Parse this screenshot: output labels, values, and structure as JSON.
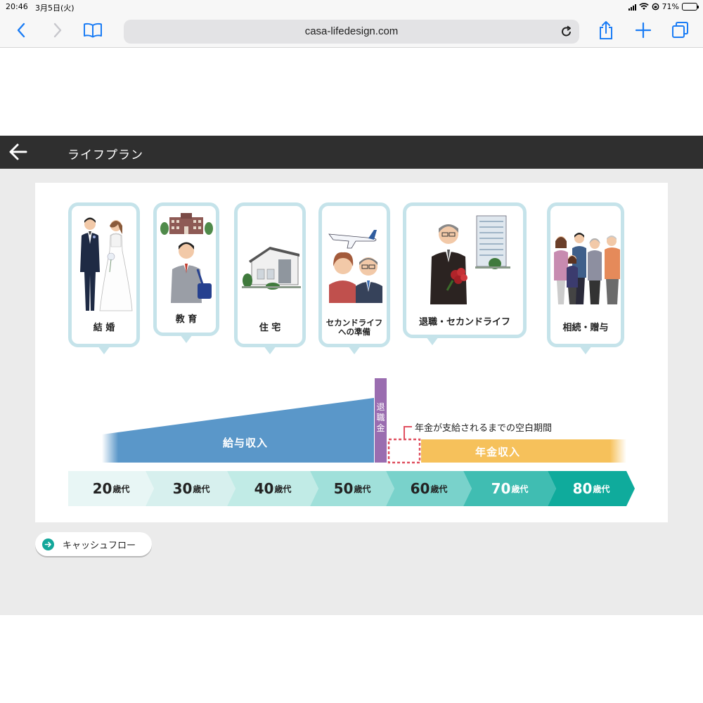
{
  "status": {
    "time": "20:46",
    "date": "3月5日(火)",
    "battery": "71%",
    "battery_level": 0.71
  },
  "browser": {
    "url": "casa-lifedesign.com"
  },
  "header": {
    "title": "ライフプラン"
  },
  "events": [
    {
      "label": "結 婚",
      "icon": "wedding-couple"
    },
    {
      "label": "教 育",
      "icon": "student-school"
    },
    {
      "label": "住 宅",
      "icon": "house"
    },
    {
      "label": "セカンドライフへの準備",
      "label_lines": [
        "セカンドライフ",
        "への準備"
      ],
      "icon": "senior-couple-airplane"
    },
    {
      "label": "退職・セカンドライフ",
      "icon": "retiree-bouquet-building"
    },
    {
      "label": "相続・贈与",
      "icon": "family-generations"
    }
  ],
  "income": {
    "salary_label": "給与収入",
    "retirement_label": "退職金",
    "retirement_chars": [
      "退",
      "職",
      "金"
    ],
    "gap_label": "年金が支給されるまでの空白期間",
    "pension_label": "年金収入"
  },
  "ages": [
    {
      "num": "20",
      "unit": "歳代"
    },
    {
      "num": "30",
      "unit": "歳代"
    },
    {
      "num": "40",
      "unit": "歳代"
    },
    {
      "num": "50",
      "unit": "歳代"
    },
    {
      "num": "60",
      "unit": "歳代"
    },
    {
      "num": "70",
      "unit": "歳代"
    },
    {
      "num": "80",
      "unit": "歳代"
    }
  ],
  "colors": {
    "accent": "#1a7cf5",
    "bubble_border": "#c5e3ea",
    "salary": "#5a97c9",
    "retirement": "#9a6db0",
    "gap": "#e05060",
    "pension": "#f6c15b",
    "age_shades": [
      "#e8f6f5",
      "#d7f0ee",
      "#c1ebe6",
      "#a0e0da",
      "#79d2cb",
      "#40bdb2",
      "#0fab9c"
    ]
  },
  "footer": {
    "cashflow_label": "キャッシュフロー"
  }
}
